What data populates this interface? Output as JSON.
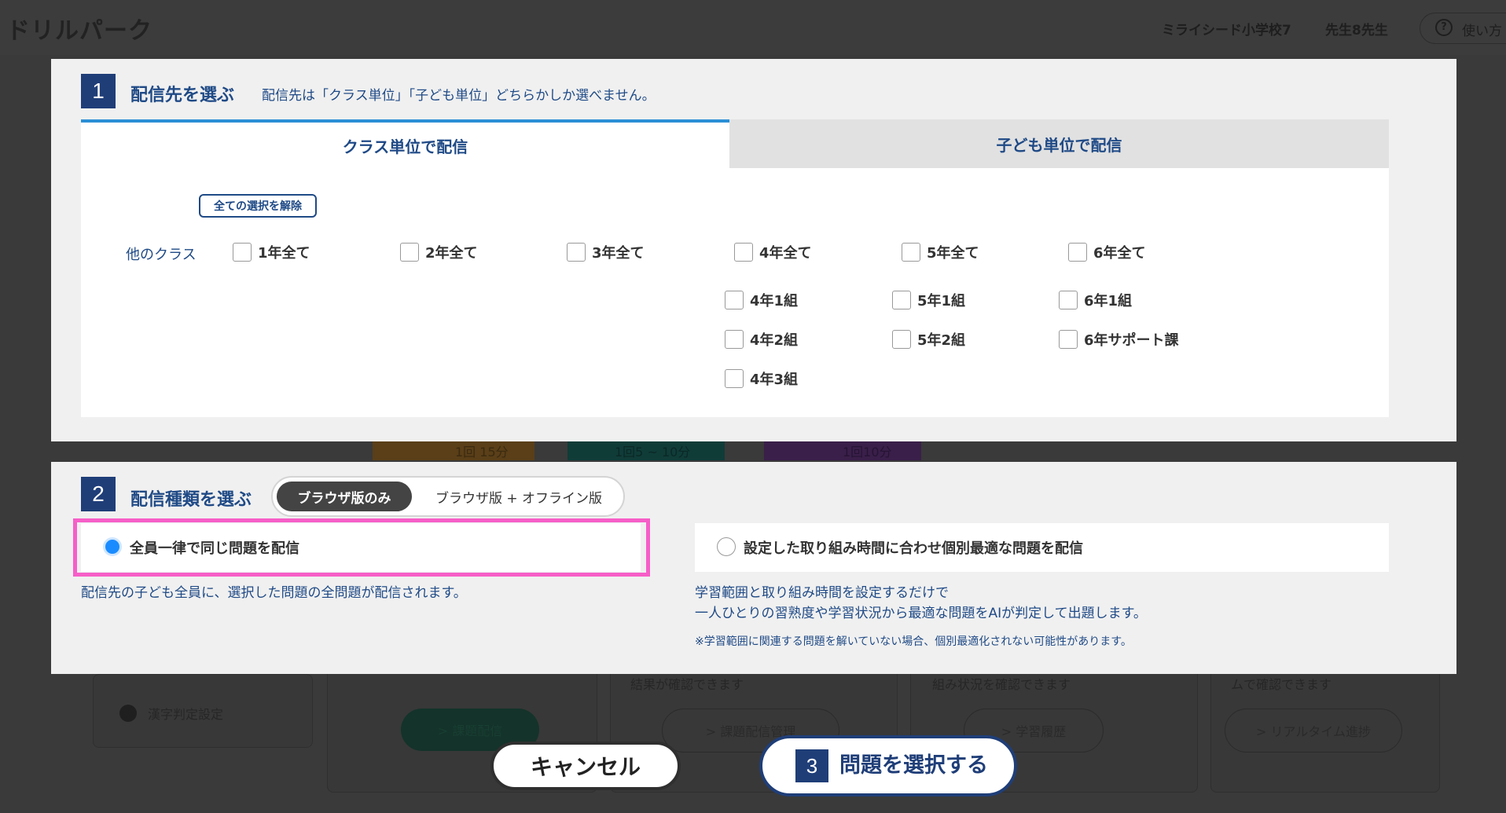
{
  "header": {
    "app_name": "ドリルパーク",
    "school": "ミライシード小学校7",
    "teacher": "先生8先生",
    "help_label": "使い方"
  },
  "background": {
    "thumb_texts": [
      "1回 15分",
      "1回5 ~ 10分",
      "1回10分"
    ],
    "kanji_setting": "漢字判定設定",
    "card_texts": [
      "結果が確認できます",
      "組み状況を確認できます",
      "ムで確認できます"
    ],
    "buttons": [
      "> 課題配信",
      "> 課題配信管理",
      "> 学習履歴",
      "> リアルタイム進捗"
    ]
  },
  "step1": {
    "number": "1",
    "title": "配信先を選ぶ",
    "note": "配信先は「クラス単位」「子ども単位」どちらかしか選べません。",
    "tabs": [
      {
        "label": "クラス単位で配信",
        "active": true
      },
      {
        "label": "子ども単位で配信",
        "active": false
      }
    ],
    "clear_label": "全ての選択を解除",
    "row_label": "他のクラス",
    "grades": [
      "1年全て",
      "2年全て",
      "3年全て",
      "4年全て",
      "5年全て",
      "6年全て"
    ],
    "classes": {
      "grade4": [
        "4年1組",
        "4年2組",
        "4年3組"
      ],
      "grade5": [
        "5年1組",
        "5年2組"
      ],
      "grade6": [
        "6年1組",
        "6年サポート課"
      ]
    }
  },
  "step2": {
    "number": "2",
    "title": "配信種類を選ぶ",
    "segment": {
      "active": "ブラウザ版のみ",
      "inactive": "ブラウザ版 + オフライン版"
    },
    "option_a": {
      "label": "全員一律で同じ問題を配信",
      "selected": true,
      "desc": "配信先の子ども全員に、選択した問題の全問題が配信されます。"
    },
    "option_b": {
      "label": "設定した取り組み時間に合わせ個別最適な問題を配信",
      "selected": false,
      "desc_line1": "学習範囲と取り組み時間を設定するだけで",
      "desc_line2": "一人ひとりの習熟度や学習状況から最適な問題をAIが判定して出題します。",
      "note": "※学習範囲に関連する問題を解いていない場合、個別最適化されない可能性があります。"
    }
  },
  "footer": {
    "cancel_label": "キャンセル",
    "select_number": "3",
    "select_label": "問題を選択する"
  },
  "colors": {
    "accent_blue": "#1f4a86",
    "step_badge": "#1f3e78",
    "tab_underline": "#2b8fd6",
    "highlight_pink": "#f65ec8",
    "radio_selected": "#1a8cff"
  }
}
